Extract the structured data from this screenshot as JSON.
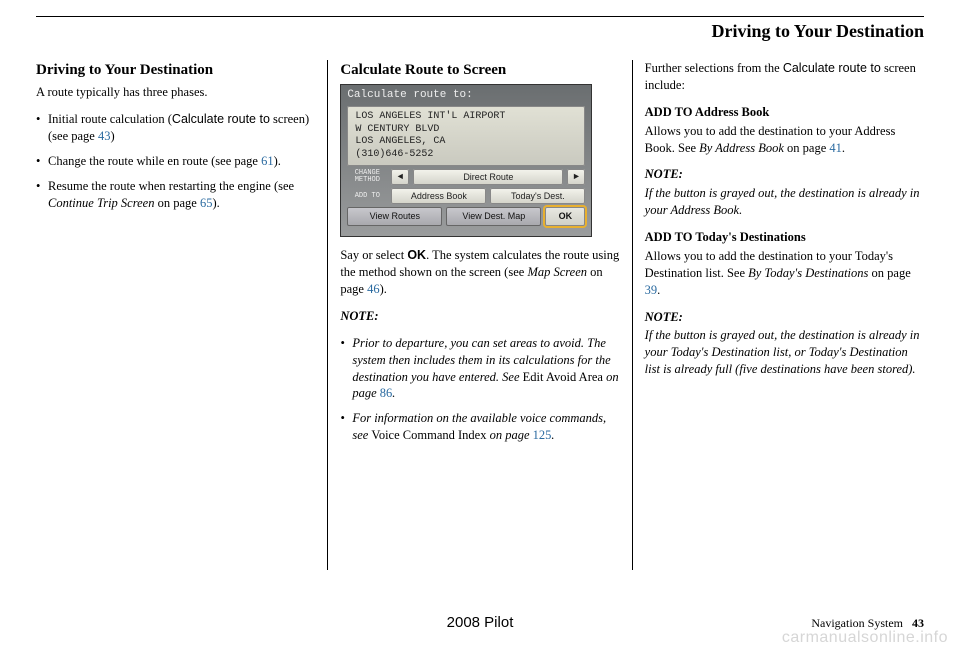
{
  "header": {
    "title": "Driving to Your Destination"
  },
  "col1": {
    "heading": "Driving to Your Destination",
    "intro": "A route typically has three phases.",
    "items": {
      "a1": "Initial route calculation (",
      "a2": "Calculate route to",
      "a3": " screen) (see page ",
      "a4": "43",
      "a5": ")",
      "b1": "Change the route while en route (see page ",
      "b2": "61",
      "b3": ").",
      "c1": "Resume the route when restarting the engine (see ",
      "c2": "Continue Trip Screen",
      "c3": " on page ",
      "c4": "65",
      "c5": ")."
    }
  },
  "col2": {
    "heading": "Calculate Route to Screen",
    "screenshot": {
      "title": "Calculate route to:",
      "addr1": "LOS ANGELES INT'L AIRPORT",
      "addr2": "W CENTURY BLVD",
      "addr3": "LOS ANGELES, CA",
      "addr4": "(310)646-5252",
      "change_label": "CHANGE METHOD",
      "addto_label": "ADD TO",
      "arrow_l": "◄",
      "direct": "Direct Route",
      "arrow_r": "►",
      "address_book": "Address Book",
      "todays": "Today's Dest.",
      "view_routes": "View Routes",
      "view_dest_map": "View Dest. Map",
      "ok": "OK"
    },
    "para1a": "Say or select ",
    "para1b": "OK",
    "para1c": ". The system calculates the route using the method shown on the screen (see ",
    "para1d": "Map Screen",
    "para1e": " on page ",
    "para1f": "46",
    "para1g": ").",
    "note_head": "NOTE:",
    "note1a": "Prior to departure, you can set areas to avoid. The system then includes them in its calculations for the destination you have entered. See ",
    "note1b": "Edit Avoid Area",
    "note1c": " on page ",
    "note1d": "86",
    "note1e": ".",
    "note2a": "For information on the available voice commands, see ",
    "note2b": "Voice Command Index",
    "note2c": " on page ",
    "note2d": "125",
    "note2e": "."
  },
  "col3": {
    "intro1": "Further selections from the ",
    "intro2": "Calculate route to",
    "intro3": " screen include:",
    "h1": "ADD TO Address Book",
    "p1a": "Allows you to add the destination to your Address Book. See ",
    "p1b": "By Address Book",
    "p1c": " on page ",
    "p1d": "41",
    "p1e": ".",
    "note_head1": "NOTE:",
    "note1": "If the button is grayed out, the destination is already in your Address Book.",
    "h2": "ADD TO Today's Destinations",
    "p2a": "Allows you to add the destination to your Today's Destination list. See ",
    "p2b": "By Today's Destinations",
    "p2c": " on page ",
    "p2d": "39",
    "p2e": ".",
    "note_head2": "NOTE:",
    "note2": "If the button is grayed out, the destination is already in your Today's Destination list, or Today's Destination list is already full (five destinations have been stored)."
  },
  "footer": {
    "model": "2008  Pilot",
    "section": "Navigation System",
    "page": "43"
  },
  "watermark": "carmanualsonline.info"
}
